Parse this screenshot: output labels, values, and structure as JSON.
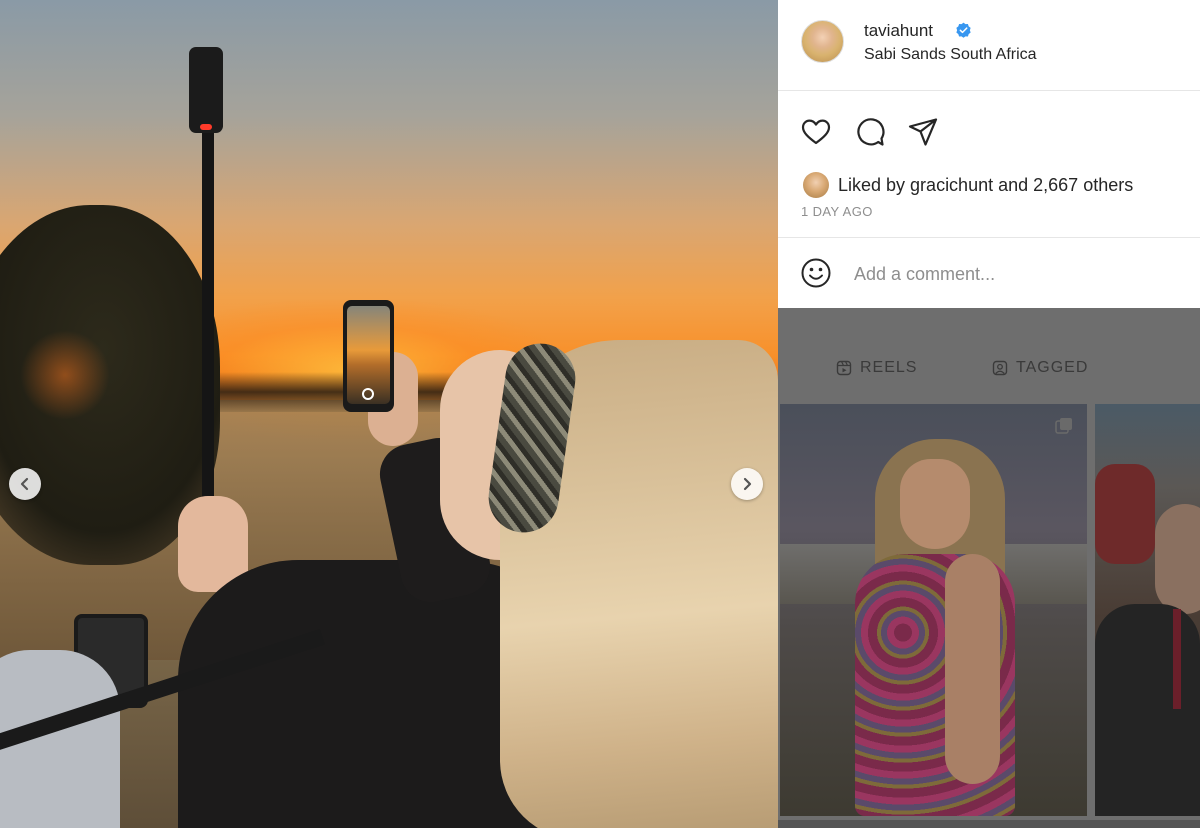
{
  "post": {
    "username": "taviahunt",
    "location": "Sabi Sands South Africa",
    "liked_by_prefix": "Liked by ",
    "liked_by_user": "gracichunt",
    "liked_by_suffix": " and 2,667 others",
    "time_ago": "1 DAY AGO",
    "comment_placeholder": "Add a comment..."
  },
  "profile_tabs": {
    "reels": "REELS",
    "tagged": "TAGGED"
  },
  "icons": {
    "verified": "verified-badge-icon",
    "like": "heart-icon",
    "comment": "comment-bubble-icon",
    "share": "paper-plane-icon",
    "emoji": "smiley-icon",
    "prev": "chevron-left-icon",
    "next": "chevron-right-icon",
    "reels_tab": "reels-icon",
    "tagged_tab": "tagged-user-icon",
    "multi_post": "carousel-icon"
  },
  "colors": {
    "verified_blue": "#3897f0",
    "text": "#262626",
    "muted": "#8e8e8e"
  }
}
